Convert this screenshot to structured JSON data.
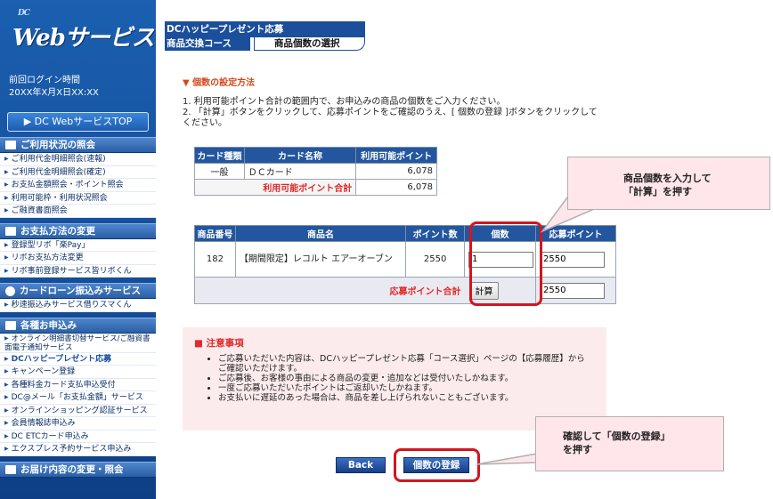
{
  "sidebar": {
    "logo_prefix": "DC",
    "logo_text": "Webサービス",
    "last_login_label": "前回ログイン時間",
    "last_login_value": "20XX年X月X日XX:XX",
    "top_button": "▶ DC WebサービスTOP",
    "sections": [
      {
        "title": "ご利用状況の照会",
        "icon": "book-icon",
        "items": [
          "ご利用代金明細照会(速報)",
          "ご利用代金明細照会(確定)",
          "お支払金額照会・ポイント照会",
          "利用可能枠・利用状況照会",
          "ご融資書面照会"
        ]
      },
      {
        "title": "お支払方法の変更",
        "icon": "card-icon",
        "items": [
          "登録型リボ「楽Pay」",
          "リボお支払方法変更",
          "リボ事前登録サービス皆リボくん"
        ]
      },
      {
        "title": "カードローン振込みサービス",
        "icon": "yen-coin-icon",
        "items": [
          "秒速振込みサービス借りスマくん"
        ]
      },
      {
        "title": "各種お申込み",
        "icon": "monitor-icon",
        "items": [
          "オンライン明細書切替サービス/ご融資書面電子通知サービス",
          "DCハッピープレゼント応募",
          "キャンペーン登録",
          "各種料金カード支払申込受付",
          "DC@メール「お支払金額」サービス",
          "オンラインショッピング認証サービス",
          "会員情報誌申込み",
          "DC ETCカード申込み",
          "エクスプレス予約サービス申込み"
        ]
      },
      {
        "title": "お届け内容の変更・照会",
        "icon": "pencil-icon",
        "items": []
      }
    ]
  },
  "header": {
    "title": "DCハッピープレゼント応募",
    "tab_course": "商品交換コース",
    "tab_quantity": "商品個数の選択"
  },
  "settings_heading": "▼ 個数の設定方法",
  "instructions": [
    "1. 利用可能ポイント合計の範囲内で、お申込みの商品の個数をご入力ください。",
    "2. 「計算」ボタンをクリックして、応募ポイントをご確認のうえ、[ 個数の登録 ]ボタンをクリックしてください。"
  ],
  "points_table": {
    "headers": [
      "カード種類",
      "カード名称",
      "利用可能ポイント"
    ],
    "rows": [
      [
        "一般",
        "ＤＣカード",
        "6,078"
      ]
    ],
    "total_label": "利用可能ポイント合計",
    "total_value": "6,078"
  },
  "items_table": {
    "headers": [
      "商品番号",
      "商品名",
      "ポイント数",
      "個数",
      "応募ポイント"
    ],
    "rows": [
      {
        "number": "182",
        "name": "【期間限定】レコルト エアーオーブン",
        "points": "2550",
        "quantity": "1",
        "apply_points": "2550"
      }
    ],
    "total_label": "応募ポイント合計",
    "calc_button": "計算",
    "total_value": "2550"
  },
  "notes": {
    "title": "■ 注意事項",
    "items": [
      "ご応募いただいた内容は、DCハッピープレゼント応募「コース選択」ページの【応募履歴】からご確認いただけます。",
      "ご応募後、お客様の事由による商品の変更・追加などは受付いたしかねます。",
      "一度ご応募いただいたポイントはご返却いたしかねます。",
      "お支払いに遅延のあった場合は、商品を差し上げられないこともございます。"
    ]
  },
  "buttons": {
    "back": "Back",
    "register": "個数の登録"
  },
  "callouts": {
    "first_line1": "商品個数を入力して",
    "first_line2": "「計算」を押す",
    "second_line1": "確認して「個数の登録」",
    "second_line2": "を押す"
  },
  "colors": {
    "sidebar_blue": "#1b5fb0",
    "header_blue": "#1b4f9c",
    "accent_red": "#d1161e",
    "heading_orange": "#d2481a",
    "notes_bg": "#fcebed",
    "callout_bg": "#ffe6ea"
  }
}
